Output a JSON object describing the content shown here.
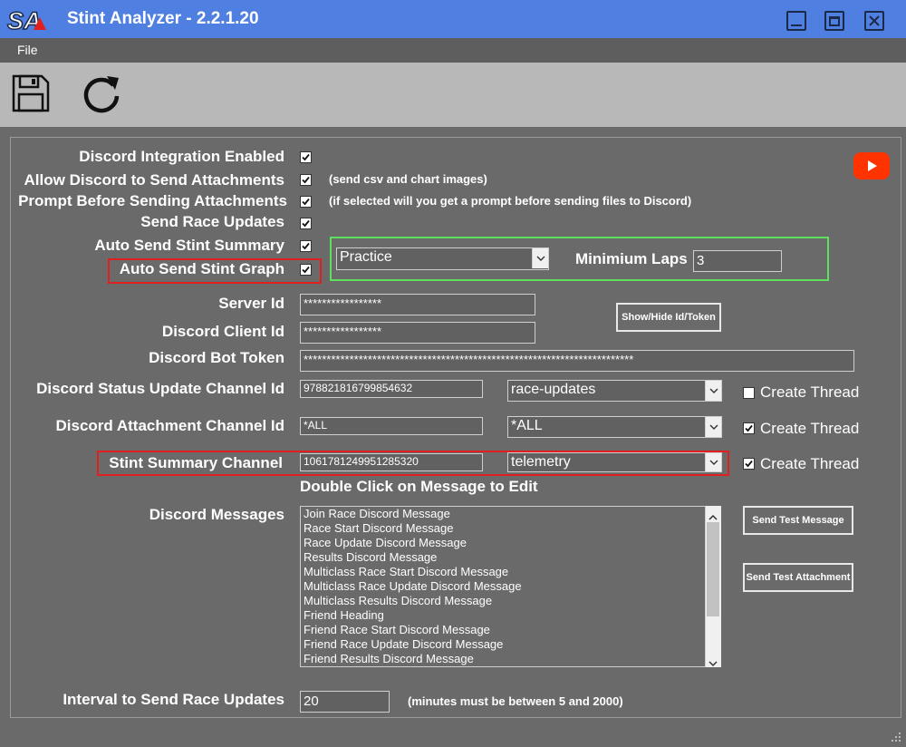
{
  "window": {
    "title": "Stint Analyzer - 2.2.1.20",
    "logo_text": "SA"
  },
  "menu": {
    "file": "File"
  },
  "colors": {
    "titlebar": "#4f7fe0",
    "panel": "#6a6a6a",
    "toolbar": "#b8b8b8",
    "highlight_red": "#e02020",
    "highlight_green": "#5ee05e",
    "youtube": "#ff3300"
  },
  "toolbar": {
    "save_icon": "save-icon",
    "refresh_icon": "refresh-icon"
  },
  "settings": {
    "discord_enabled": {
      "label": "Discord Integration Enabled",
      "checked": true
    },
    "allow_attachments": {
      "label": "Allow Discord to Send Attachments",
      "checked": true,
      "note": "(send csv and chart images)"
    },
    "prompt_attachments": {
      "label": "Prompt Before Sending Attachments",
      "checked": true,
      "note": "(if selected will you get a prompt before sending files to Discord)"
    },
    "send_race_updates": {
      "label": "Send Race Updates",
      "checked": true
    },
    "auto_stint_summary": {
      "label": "Auto Send Stint Summary",
      "checked": true
    },
    "auto_stint_graph": {
      "label": "Auto Send Stint Graph",
      "checked": true
    },
    "session_type": {
      "value": "Practice"
    },
    "minimum_laps": {
      "label": "Minimium Laps",
      "value": "3"
    }
  },
  "credentials": {
    "server_id": {
      "label": "Server Id",
      "value": "*****************"
    },
    "client_id": {
      "label": "Discord Client Id",
      "value": "*****************"
    },
    "bot_token": {
      "label": "Discord Bot Token",
      "value": "************************************************************************"
    },
    "show_hide_button": "Show/Hide Id/Token"
  },
  "channels": {
    "status_update": {
      "label": "Discord Status Update Channel Id",
      "id": "978821816799854632",
      "name": "race-updates",
      "create_thread_label": "Create Thread",
      "create_thread": false
    },
    "attachment": {
      "label": "Discord Attachment Channel Id",
      "id": "*ALL",
      "name": "*ALL",
      "create_thread_label": "Create Thread",
      "create_thread": true
    },
    "stint_summary": {
      "label": "Stint Summary Channel",
      "id": "1061781249951285320",
      "name": "telemetry",
      "create_thread_label": "Create Thread",
      "create_thread": true
    }
  },
  "messages": {
    "hint": "Double Click on Message to Edit",
    "label": "Discord Messages",
    "items": [
      "Join Race Discord Message",
      "Race Start Discord Message",
      "Race Update Discord Message",
      "Results Discord Message",
      "Multiclass Race Start Discord Message",
      "Multiclass Race Update Discord Message",
      "Multiclass Results Discord Message",
      "Friend Heading",
      "Friend Race Start Discord Message",
      "Friend Race Update Discord Message",
      "Friend Results Discord Message"
    ],
    "send_test_message": "Send Test Message",
    "send_test_attachment": "Send Test Attachment"
  },
  "interval": {
    "label": "Interval to Send Race Updates",
    "value": "20",
    "note": "(minutes must be between 5 and 2000)"
  }
}
